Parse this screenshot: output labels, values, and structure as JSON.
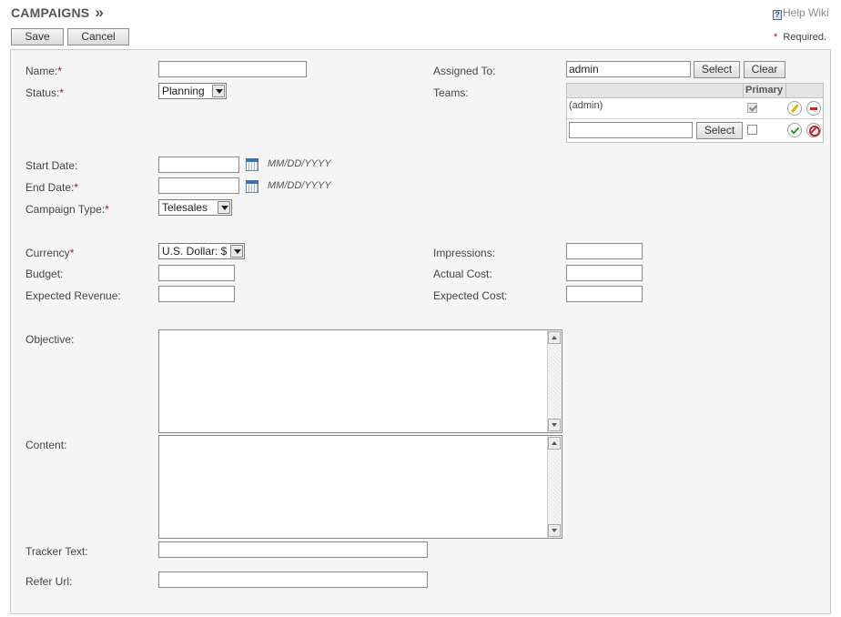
{
  "header": {
    "title": "CAMPAIGNS",
    "chevron": "»",
    "help_icon": "question-book-icon",
    "help_label": "Help Wiki"
  },
  "toolbar": {
    "save_label": "Save",
    "cancel_label": "Cancel",
    "required_marker": "*",
    "required_text": "Required."
  },
  "colors": {
    "required": "#cc0000",
    "panel_bg": "#f5f5f5",
    "border": "#c9c9c9"
  },
  "form": {
    "name": {
      "label": "Name:",
      "required": "*",
      "value": ""
    },
    "status": {
      "label": "Status:",
      "required": "*",
      "value": "Planning"
    },
    "assigned_to": {
      "label": "Assigned To:",
      "value": "admin",
      "select_label": "Select",
      "clear_label": "Clear"
    },
    "teams": {
      "label": "Teams:",
      "primary_header": "Primary",
      "rows": [
        {
          "name": "(admin)",
          "primary": true
        }
      ],
      "new_row": {
        "value": "",
        "select_label": "Select",
        "primary": false
      }
    },
    "start_date": {
      "label": "Start Date:",
      "value": "",
      "format": "MM/DD/YYYY"
    },
    "end_date": {
      "label": "End Date:",
      "required": "*",
      "value": "",
      "format": "MM/DD/YYYY"
    },
    "campaign_type": {
      "label": "Campaign Type:",
      "required": "*",
      "value": "Telesales"
    },
    "currency": {
      "label": "Currency",
      "required": "*",
      "value": "U.S. Dollar: $"
    },
    "impressions": {
      "label": "Impressions:",
      "value": ""
    },
    "budget": {
      "label": "Budget:",
      "value": ""
    },
    "actual_cost": {
      "label": "Actual Cost:",
      "value": ""
    },
    "expected_revenue": {
      "label": "Expected Revenue:",
      "value": ""
    },
    "expected_cost": {
      "label": "Expected Cost:",
      "value": ""
    },
    "objective": {
      "label": "Objective:",
      "value": ""
    },
    "content": {
      "label": "Content:",
      "value": ""
    },
    "tracker_text": {
      "label": "Tracker Text:",
      "value": ""
    },
    "refer_url": {
      "label": "Refer Url:",
      "value": ""
    }
  }
}
